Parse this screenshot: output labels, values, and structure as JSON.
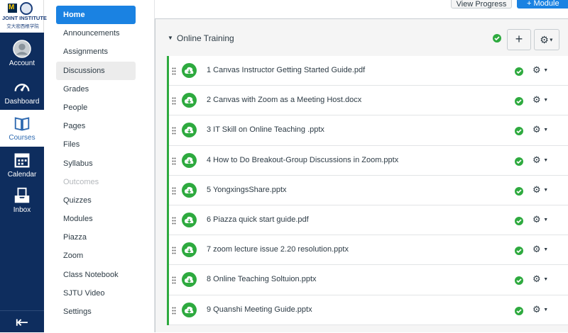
{
  "brand": {
    "logo_line1": "JOINT INSTITUTE",
    "logo_line2": "交大密西根学院"
  },
  "global_nav": [
    {
      "label": "Account",
      "icon": "account-icon"
    },
    {
      "label": "Dashboard",
      "icon": "dashboard-icon"
    },
    {
      "label": "Courses",
      "icon": "courses-icon"
    },
    {
      "label": "Calendar",
      "icon": "calendar-icon"
    },
    {
      "label": "Inbox",
      "icon": "inbox-icon"
    }
  ],
  "course_nav": [
    "Home",
    "Announcements",
    "Assignments",
    "Discussions",
    "Grades",
    "People",
    "Pages",
    "Files",
    "Syllabus",
    "Outcomes",
    "Quizzes",
    "Modules",
    "Piazza",
    "Zoom",
    "Class Notebook",
    "SJTU Video",
    "Settings"
  ],
  "toolbar": {
    "view_progress": "View Progress",
    "add_module": "+ Module"
  },
  "module": {
    "title": "Online Training",
    "add_symbol": "+",
    "items": [
      "1 Canvas Instructor Getting Started Guide.pdf",
      "2 Canvas with Zoom as a Meeting Host.docx",
      "3 IT Skill on Online Teaching .pptx",
      "4 How to Do Breakout-Group Discussions in Zoom.pptx",
      "5 YongxingsShare.pptx",
      "6 Piazza quick start guide.pdf",
      "7 zoom lecture issue 2.20 resolution.pptx",
      "8 Online Teaching Soltuion.pptx",
      "9 Quanshi Meeting Guide.pptx"
    ]
  },
  "colors": {
    "nav_bg": "#0e2d5e",
    "accent": "#1a82e2",
    "published": "#2eaa3f"
  }
}
